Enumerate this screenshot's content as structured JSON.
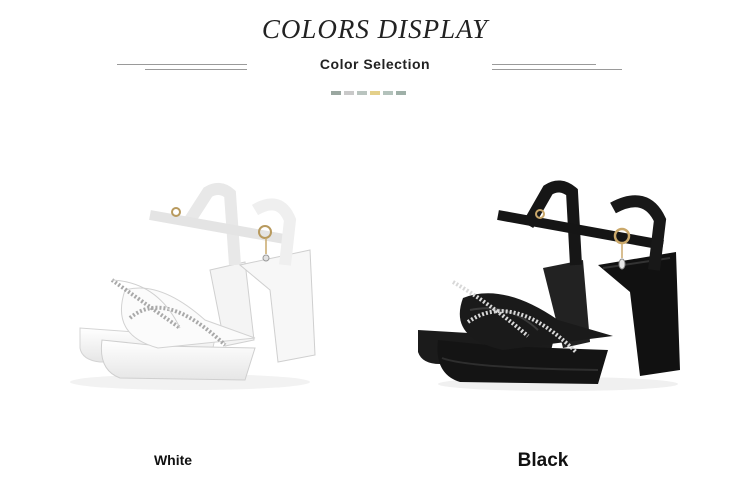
{
  "header": {
    "title": "COLORS DISPLAY",
    "subtitle": "Color Selection",
    "swatch_colors": [
      "#9aa7a0",
      "#c9c9c9",
      "#b9c4bf",
      "#e4d08a",
      "#b3c2bb",
      "#9fb0a8"
    ]
  },
  "products": [
    {
      "caption": "White",
      "image": "white-heeled-sandal",
      "color": "#ffffff"
    },
    {
      "caption": "Black",
      "image": "black-heeled-sandal",
      "color": "#111111"
    }
  ]
}
